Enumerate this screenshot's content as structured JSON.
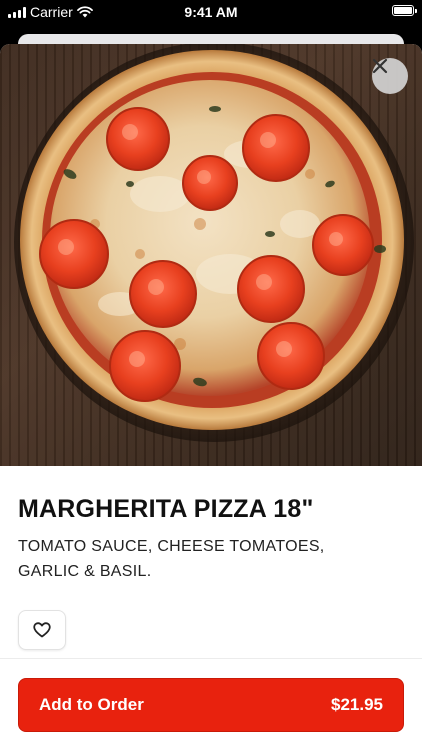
{
  "status_bar": {
    "carrier": "Carrier",
    "time": "9:41 AM"
  },
  "item": {
    "name": "MARGHERITA PIZZA 18\"",
    "description": "TOMATO SAUCE, CHEESE TOMATOES, GARLIC & BASIL."
  },
  "actions": {
    "add_label": "Add to Order",
    "price": "$21.95"
  },
  "icons": {
    "close": "close-icon",
    "favorite": "heart-outline-icon",
    "wifi": "wifi-icon",
    "signal": "signal-icon",
    "battery": "battery-icon"
  },
  "colors": {
    "accent": "#e8220e",
    "title": "#111111"
  }
}
